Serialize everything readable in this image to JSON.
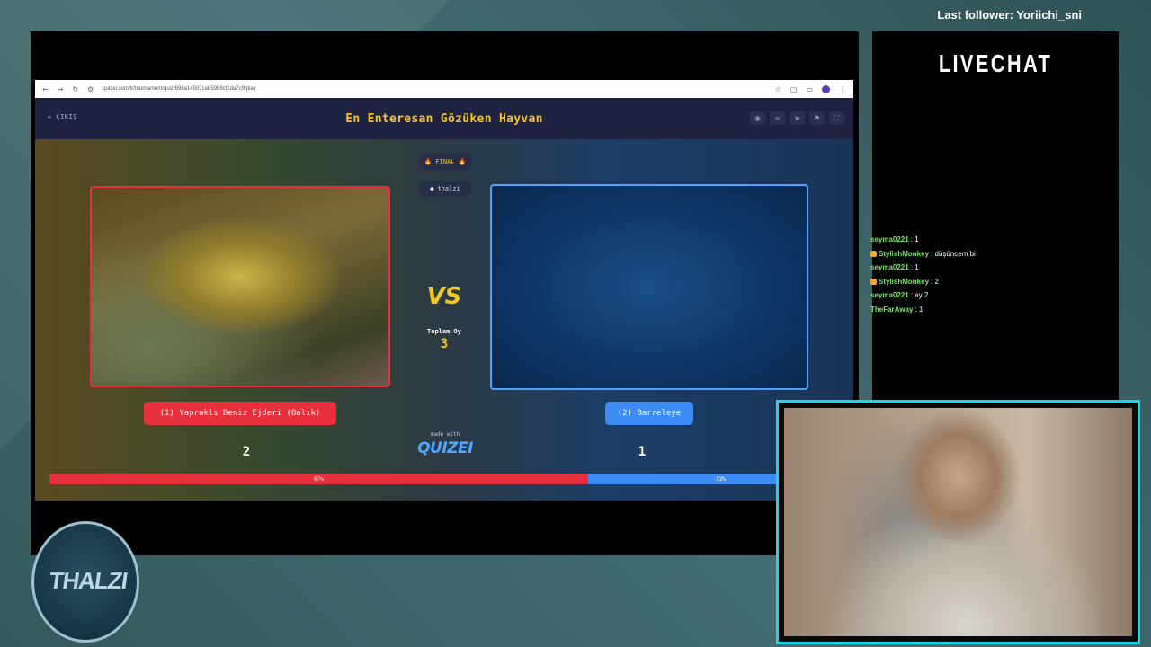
{
  "overlay": {
    "last_follower": "Last follower: Yoriichi_sni",
    "logo_text": "THALZI"
  },
  "browser": {
    "url": "quizei.com/tr/tournament/quiz/696a14507cab5988cf1da7c9/play"
  },
  "quiz": {
    "exit_label": "ÇIKIŞ",
    "title": "En Enteresan Gözüken Hayvan",
    "round_badge": "FİNAL",
    "host_name": "thalzi",
    "vs_text": "VS",
    "total_label": "Toplam Oy",
    "total_votes": "3",
    "left": {
      "label": "(1) Yapraklı Deniz Ejderi (Balık)",
      "votes": "2",
      "percent_label": "67%",
      "percent": 67
    },
    "right": {
      "label": "(2) Barreleye",
      "votes": "1",
      "percent_label": "33%",
      "percent": 33
    },
    "made_with": "made with",
    "brand": "QUIZEI"
  },
  "livechat": {
    "title": "LIVECHAT",
    "messages": [
      {
        "user": "seyma0221",
        "text": " : 1",
        "badge": false
      },
      {
        "user": "StylishMonkey",
        "text": " : düşüncem bi",
        "badge": true
      },
      {
        "user": "seyma0221",
        "text": " : 1",
        "badge": false
      },
      {
        "user": "StylishMonkey",
        "text": " : 2",
        "badge": true
      },
      {
        "user": "seyma0221",
        "text": " : ay 2",
        "badge": false
      },
      {
        "user": "TheFarAway",
        "text": " : 1",
        "badge": false
      }
    ]
  },
  "colors": {
    "accent_red": "#e8303d",
    "accent_blue": "#3d8cf5",
    "title_yellow": "#f3c623",
    "webcam_border": "#17d6e8"
  }
}
